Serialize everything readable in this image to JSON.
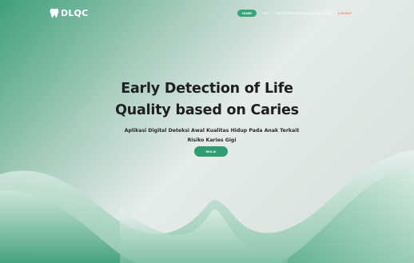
{
  "brand": {
    "name": "DLQC"
  },
  "nav": {
    "home": "HOME",
    "app": "APP",
    "email": "MIKEALIVERSTENSEN@GMAIL.COM",
    "logout": "LOGOUT"
  },
  "hero": {
    "title_line1": "Early Detection of Life",
    "title_line2": "Quality based on Caries",
    "subtitle_line1": "Aplikasi Digital Deteksi Awal Kualitas Hidup Pada Anak Terkait",
    "subtitle_line2": "Risiko Karies Gigi",
    "cta_label": "MULAI"
  },
  "colors": {
    "accent": "#3aa57c",
    "logout": "#f07a5e",
    "title": "#1f1f1f"
  },
  "icons": {
    "logo": "tooth-icon"
  }
}
